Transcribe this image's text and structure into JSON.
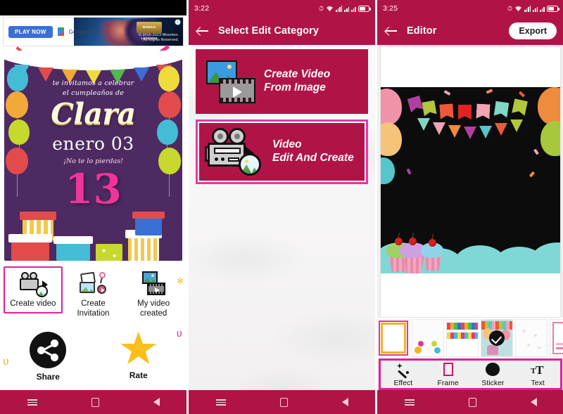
{
  "screens": {
    "home": {
      "ad": {
        "play_now": "PLAY NOW",
        "store": "Google Play",
        "copyright": "© 2016-2023 Moonton.\nAll Rights Reserved.",
        "logo": "MOBILE LEGENDS",
        "info_badge": "i"
      },
      "invitation": {
        "line1": "te invitamos a celebrar",
        "line2": "el cumpleaños de",
        "name": "Clara",
        "date": "enero 03",
        "subtitle": "¡No te lo pierdas!",
        "age": "13"
      },
      "actions": [
        {
          "label": "Create video",
          "icon": "video-camera-icon",
          "selected": true
        },
        {
          "label": "Create\nInvitation",
          "icon": "invitation-card-icon",
          "selected": false
        },
        {
          "label": "My video\ncreated",
          "icon": "film-gallery-icon",
          "selected": false
        }
      ],
      "secondary_actions": [
        {
          "label": "Share",
          "icon": "share-icon"
        },
        {
          "label": "Rate",
          "icon": "star-icon"
        }
      ],
      "navbar": {
        "menu": "menu-icon",
        "home": "home-icon",
        "back": "back-icon"
      }
    },
    "select_category": {
      "status": {
        "time": "3:22",
        "icons": [
          "clock-icon",
          "alarm-icon",
          "wifi-icon",
          "signal-icon",
          "signal-icon",
          "battery-icon"
        ]
      },
      "title": "Select Edit Category",
      "back": "back-arrow-icon",
      "cards": [
        {
          "label": "Create Video\nFrom Image",
          "icon": "image-to-video-icon",
          "selected": false
        },
        {
          "label": "Video\nEdit And Create",
          "icon": "video-camera-edit-icon",
          "selected": true
        }
      ],
      "navbar": {
        "menu": "menu-icon",
        "home": "home-icon",
        "back": "back-icon"
      }
    },
    "editor": {
      "status": {
        "time": "3:25",
        "icons": [
          "message-icon",
          "clock-icon",
          "alarm-icon",
          "wifi-icon",
          "signal-icon",
          "signal-icon",
          "battery-icon"
        ]
      },
      "title": "Editor",
      "back": "back-arrow-icon",
      "export_label": "Export",
      "frames": [
        {
          "name": "frame-1",
          "selected": false
        },
        {
          "name": "frame-2",
          "selected": false
        },
        {
          "name": "frame-3",
          "selected": false
        },
        {
          "name": "frame-4",
          "selected": true
        },
        {
          "name": "frame-5",
          "selected": false
        },
        {
          "name": "frame-6",
          "selected": false
        }
      ],
      "tools": [
        {
          "label": "Effect",
          "icon": "magic-wand-icon"
        },
        {
          "label": "Frame",
          "icon": "frame-icon"
        },
        {
          "label": "Sticker",
          "icon": "sticker-icon"
        },
        {
          "label": "Text",
          "icon": "text-icon"
        }
      ],
      "navbar": {
        "menu": "menu-icon",
        "home": "home-icon",
        "back": "back-icon"
      }
    }
  },
  "colors": {
    "primary": "#B01447",
    "accent": "#E0219B",
    "star": "#FBBE1A",
    "card_purple": "#4E2A63",
    "canvas_black": "#0C0C0C",
    "cloud_teal": "#7FD8D5"
  }
}
